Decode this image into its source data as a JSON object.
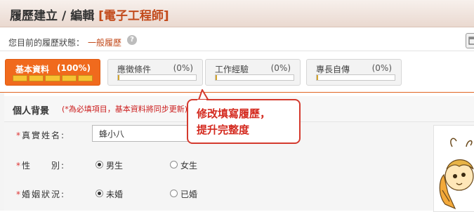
{
  "header": {
    "title_main": "履歷建立",
    "title_sep": "/",
    "title_sub": "編輯",
    "resume_name": "[電子工程師]"
  },
  "status": {
    "label": "您目前的履歷狀態：",
    "value": "一般履歷",
    "help_icon": "?"
  },
  "tabs": [
    {
      "label": "基本資料",
      "percent": "(100%)",
      "progress": 1.0
    },
    {
      "label": "應徵條件",
      "percent": "(0%)",
      "progress": 0.0
    },
    {
      "label": "工作經驗",
      "percent": "(0%)",
      "progress": 0.0
    },
    {
      "label": "專長自傳",
      "percent": "(0%)",
      "progress": 0.0
    }
  ],
  "section": {
    "title": "個人背景",
    "note": "(*為必填項目，基本資料將同步更新)"
  },
  "form": {
    "required_mark": "*",
    "name_label": "真實姓名:",
    "name_value": "蜂小八",
    "gender_label": "性　　別:",
    "gender_options": [
      "男生",
      "女生"
    ],
    "gender_selected": "男生",
    "marital_label": "婚姻狀況:",
    "marital_options": [
      "未婚",
      "已婚"
    ],
    "marital_selected": "未婚"
  },
  "callout": {
    "line1": "修改填寫履歷，",
    "line2": "提升完整度"
  },
  "colors": {
    "accent": "#f06a1d",
    "highlight_red": "#c24a1b",
    "required_red": "#d33333",
    "progress_fill": "#f6c232"
  },
  "icons": {
    "help": "question-circle-icon",
    "corner": "window-icon",
    "avatar": "bee-mascot-avatar"
  }
}
